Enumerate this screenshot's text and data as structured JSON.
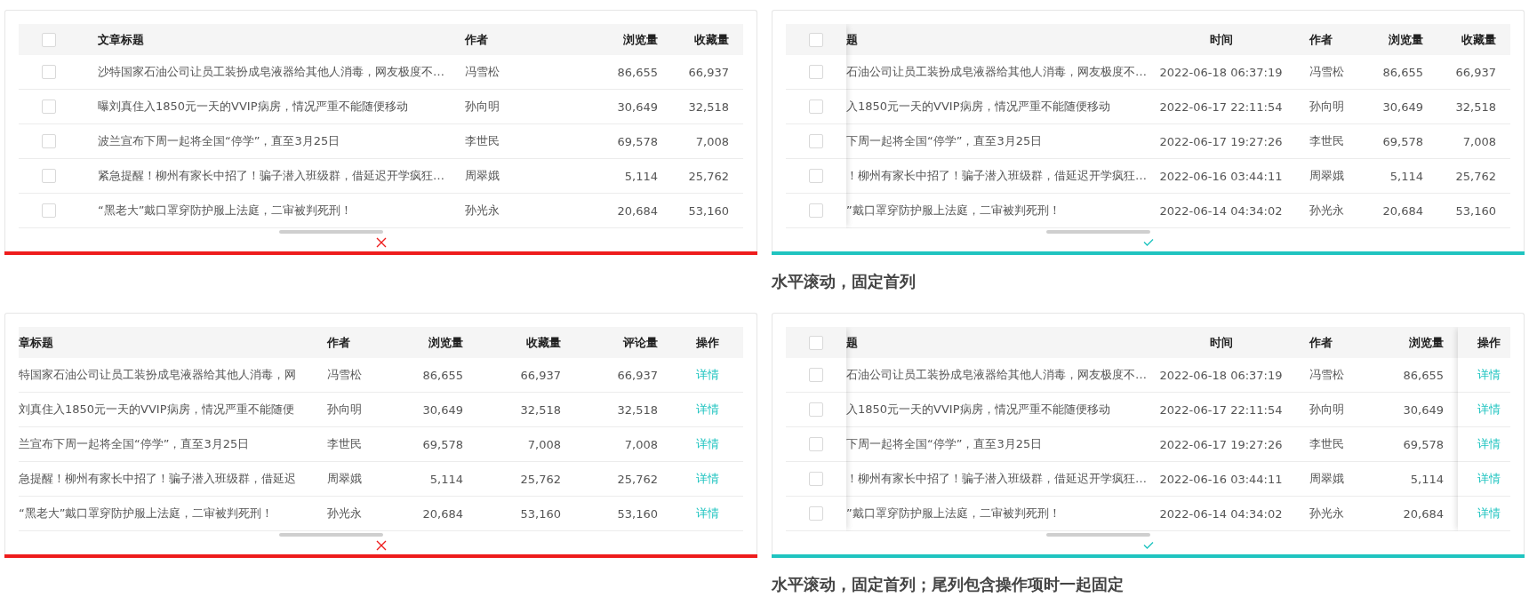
{
  "panels": [
    {
      "kind": "bad",
      "checkbox": {
        "checked": false,
        "fixed": false
      },
      "columns": [
        {
          "kind": "text",
          "label": "文章标题",
          "fixed": false
        },
        {
          "kind": "text",
          "label": "作者",
          "fixed": false
        },
        {
          "kind": "num",
          "label": "浏览量",
          "fixed": false
        },
        {
          "kind": "num",
          "label": "收藏量",
          "fixed": false
        }
      ],
      "rows": [
        {
          "checked": false,
          "cells": [
            "沙特国家石油公司让员工装扮成皂液器给其他人消毒，网友极度不…",
            "冯雪松",
            "86,655",
            "66,937"
          ]
        },
        {
          "checked": false,
          "cells": [
            "曝刘真住入1850元一天的VVIP病房，情况严重不能随便移动",
            "孙向明",
            "30,649",
            "32,518"
          ]
        },
        {
          "checked": false,
          "cells": [
            "波兰宣布下周一起将全国“停学”，直至3月25日",
            "李世民",
            "69,578",
            "7,008"
          ]
        },
        {
          "checked": false,
          "cells": [
            "紧急提醒！柳州有家长中招了！骗子潜入班级群，借延迟开学疯狂…",
            "周翠娥",
            "5,114",
            "25,762"
          ]
        },
        {
          "checked": false,
          "cells": [
            "“黑老大”戴口罩穿防护服上法庭，二审被判死刑！",
            "孙光永",
            "20,684",
            "53,160"
          ]
        }
      ]
    },
    {
      "kind": "good",
      "caption": "水平滚动，固定首列",
      "checkbox": {
        "checked": false,
        "fixed": true
      },
      "columns": [
        {
          "kind": "text",
          "label": "题",
          "fixed": false
        },
        {
          "kind": "time",
          "label": "时间",
          "fixed": false
        },
        {
          "kind": "text",
          "label": "作者",
          "fixed": false
        },
        {
          "kind": "num",
          "label": "浏览量",
          "fixed": false
        },
        {
          "kind": "num",
          "label": "收藏量",
          "fixed": false
        }
      ],
      "rows": [
        {
          "checked": false,
          "cells": [
            "石油公司让员工装扮成皂液器给其他人消毒，网友极度不…",
            "2022-06-18 06:37:19",
            "冯雪松",
            "86,655",
            "66,937"
          ]
        },
        {
          "checked": false,
          "cells": [
            "入1850元一天的VVIP病房，情况严重不能随便移动",
            "2022-06-17 22:11:54",
            "孙向明",
            "30,649",
            "32,518"
          ]
        },
        {
          "checked": false,
          "cells": [
            "下周一起将全国“停学”，直至3月25日",
            "2022-06-17 19:27:26",
            "李世民",
            "69,578",
            "7,008"
          ]
        },
        {
          "checked": false,
          "cells": [
            "！柳州有家长中招了！骗子潜入班级群，借延迟开学疯狂…",
            "2022-06-16 03:44:11",
            "周翠娥",
            "5,114",
            "25,762"
          ]
        },
        {
          "checked": false,
          "cells": [
            "”戴口罩穿防护服上法庭，二审被判死刑！",
            "2022-06-14 04:34:02",
            "孙光永",
            "20,684",
            "53,160"
          ]
        }
      ]
    },
    {
      "kind": "bad",
      "columns": [
        {
          "kind": "text",
          "label": "章标题",
          "fixed": false
        },
        {
          "kind": "text",
          "label": "作者",
          "fixed": false
        },
        {
          "kind": "num",
          "label": "浏览量",
          "fixed": false
        },
        {
          "kind": "num",
          "label": "收藏量",
          "fixed": false
        },
        {
          "kind": "num",
          "label": "评论量",
          "fixed": false
        },
        {
          "kind": "link",
          "label": "操作",
          "fixed": false
        }
      ],
      "rows": [
        {
          "cells": [
            "特国家石油公司让员工装扮成皂液器给其他人消毒，网",
            "冯雪松",
            "86,655",
            "66,937",
            "66,937",
            "详情"
          ]
        },
        {
          "cells": [
            "刘真住入1850元一天的VVIP病房，情况严重不能随便",
            "孙向明",
            "30,649",
            "32,518",
            "32,518",
            "详情"
          ]
        },
        {
          "cells": [
            "兰宣布下周一起将全国“停学”，直至3月25日",
            "李世民",
            "69,578",
            "7,008",
            "7,008",
            "详情"
          ]
        },
        {
          "cells": [
            "急提醒！柳州有家长中招了！骗子潜入班级群，借延迟",
            "周翠娥",
            "5,114",
            "25,762",
            "25,762",
            "详情"
          ]
        },
        {
          "cells": [
            "“黑老大”戴口罩穿防护服上法庭，二审被判死刑！",
            "孙光永",
            "20,684",
            "53,160",
            "53,160",
            "详情"
          ]
        }
      ]
    },
    {
      "kind": "good",
      "caption": "水平滚动，固定首列；尾列包含操作项时一起固定",
      "checkbox": {
        "checked": false,
        "fixed": true
      },
      "columns": [
        {
          "kind": "text",
          "label": "题",
          "fixed": false
        },
        {
          "kind": "time",
          "label": "时间",
          "fixed": false
        },
        {
          "kind": "text",
          "label": "作者",
          "fixed": false
        },
        {
          "kind": "num",
          "label": "浏览量",
          "fixed": false
        },
        {
          "kind": "link",
          "label": "操作",
          "fixed": true
        }
      ],
      "rows": [
        {
          "checked": false,
          "cells": [
            "石油公司让员工装扮成皂液器给其他人消毒，网友极度不…",
            "2022-06-18 06:37:19",
            "冯雪松",
            "86,655",
            "详情"
          ]
        },
        {
          "checked": false,
          "cells": [
            "入1850元一天的VVIP病房，情况严重不能随便移动",
            "2022-06-17 22:11:54",
            "孙向明",
            "30,649",
            "详情"
          ]
        },
        {
          "checked": false,
          "cells": [
            "下周一起将全国“停学”，直至3月25日",
            "2022-06-17 19:27:26",
            "李世民",
            "69,578",
            "详情"
          ]
        },
        {
          "checked": false,
          "cells": [
            "！柳州有家长中招了！骗子潜入班级群，借延迟开学疯狂…",
            "2022-06-16 03:44:11",
            "周翠娥",
            "5,114",
            "详情"
          ]
        },
        {
          "checked": false,
          "cells": [
            "”戴口罩穿防护服上法庭，二审被判死刑！",
            "2022-06-14 04:34:02",
            "孙光永",
            "20,684",
            "详情"
          ]
        }
      ]
    }
  ]
}
